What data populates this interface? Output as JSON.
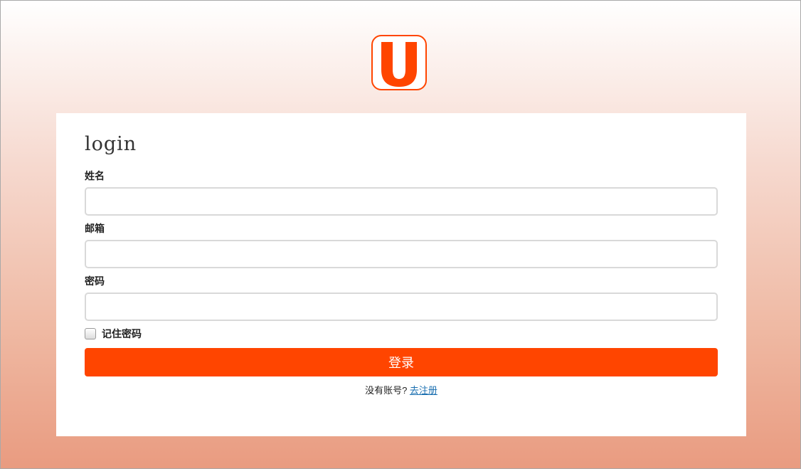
{
  "logo": {
    "letter": "U",
    "color": "#ff4500"
  },
  "form": {
    "title": "login",
    "fields": [
      {
        "label": "姓名",
        "value": ""
      },
      {
        "label": "邮箱",
        "value": ""
      },
      {
        "label": "密码",
        "value": ""
      }
    ],
    "remember_label": "记住密码",
    "remember_checked": false,
    "submit_label": "登录",
    "signup_prompt": "没有账号?",
    "signup_link": "去注册"
  },
  "colors": {
    "accent": "#ff4500",
    "link": "#1a6fb0"
  }
}
